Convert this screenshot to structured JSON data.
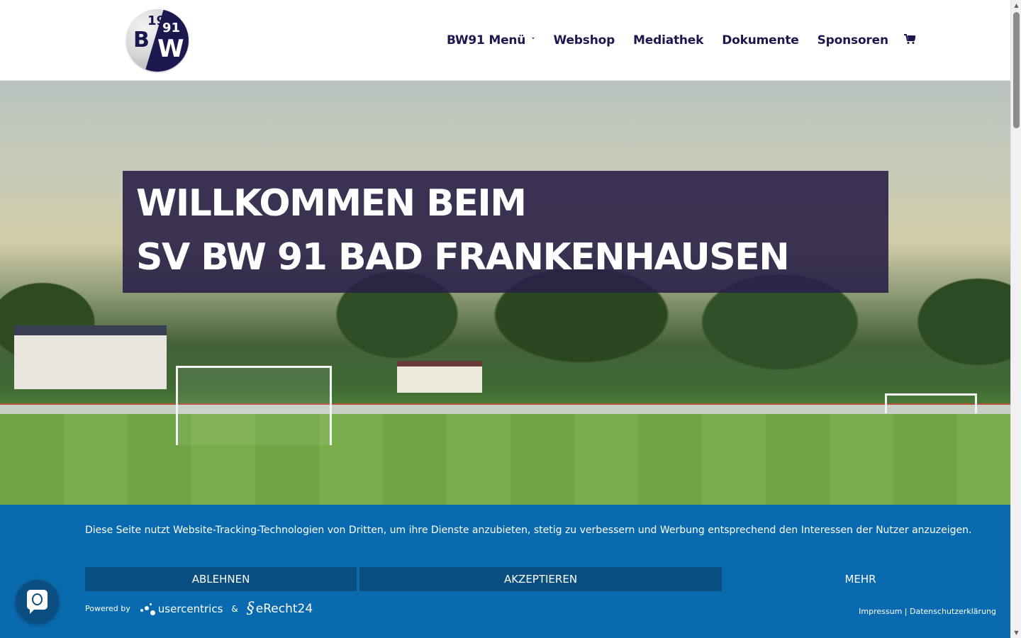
{
  "header": {
    "logo": {
      "text_top_left": "19",
      "text_top_right": "91",
      "text_bottom_left": "B",
      "text_bottom_right": "W"
    },
    "nav": [
      {
        "label": "BW91 Menü",
        "has_dropdown": true
      },
      {
        "label": "Webshop"
      },
      {
        "label": "Mediathek"
      },
      {
        "label": "Dokumente"
      },
      {
        "label": "Sponsoren"
      }
    ],
    "cart_icon": "shopping-cart-icon"
  },
  "hero": {
    "title_line1": "WILLKOMMEN BEIM",
    "title_line2": "SV BW 91 BAD FRANKENHAUSEN"
  },
  "consent": {
    "text": "Diese Seite nutzt Website-Tracking-Technologien von Dritten, um ihre Dienste anzubieten, stetig zu verbessern und Werbung entsprechend den Interessen der Nutzer anzuzeigen.",
    "reject_label": "ABLEHNEN",
    "accept_label": "AKZEPTIEREN",
    "more_label": "MEHR",
    "powered_by": "Powered by",
    "usercentrics": "usercentrics",
    "ampersand": "&",
    "erecht24": "eRecht24",
    "impressum": "Impressum",
    "separator": "|",
    "datenschutz": "Datenschutzerklärung",
    "background_color": "#0a6aaf"
  },
  "colors": {
    "brand": "#1b1850",
    "title_box": "#2b2148"
  }
}
